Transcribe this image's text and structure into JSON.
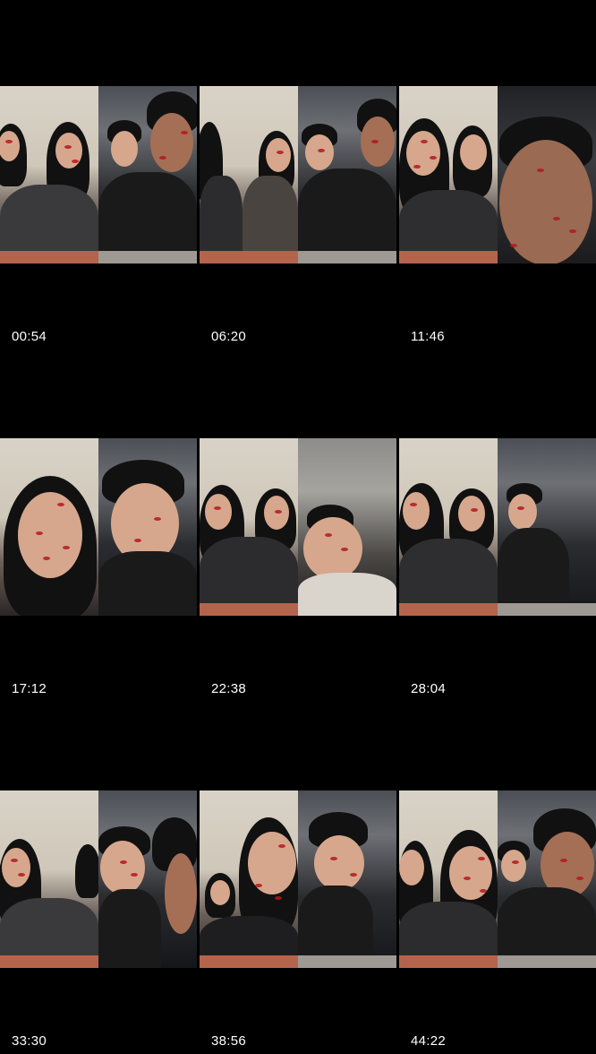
{
  "grid": {
    "tiles": [
      {
        "timestamp": "00:54"
      },
      {
        "timestamp": "06:20"
      },
      {
        "timestamp": "11:46"
      },
      {
        "timestamp": "17:12"
      },
      {
        "timestamp": "22:38"
      },
      {
        "timestamp": "28:04"
      },
      {
        "timestamp": "33:30"
      },
      {
        "timestamp": "38:56"
      },
      {
        "timestamp": "44:22"
      }
    ]
  },
  "colors": {
    "background": "#000000",
    "timestamp_text": "#ffffff",
    "table": "#b5644c",
    "kiss_mark": "#b3161e"
  }
}
